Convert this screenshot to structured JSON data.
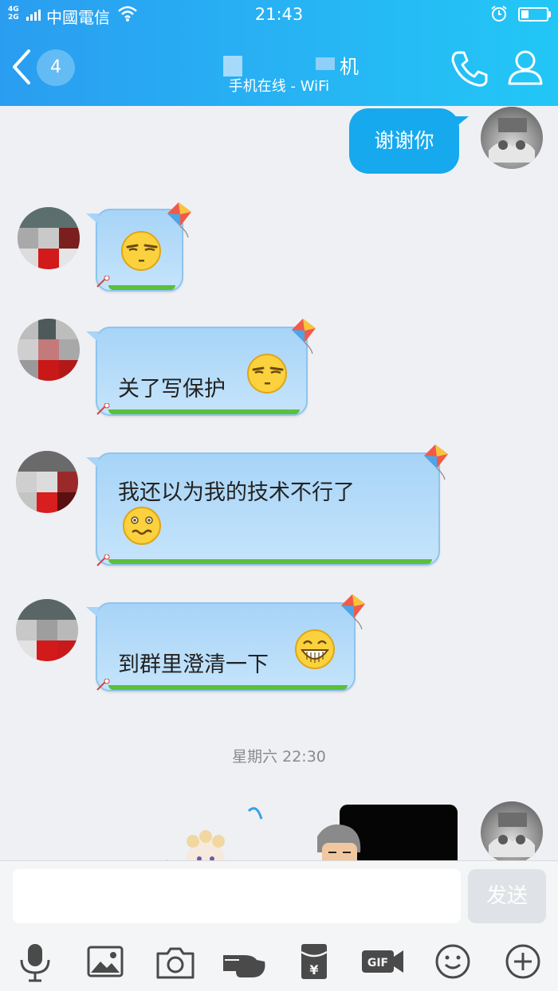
{
  "status_bar": {
    "network_type": "4G 2G",
    "carrier": "中國電信",
    "time": "21:43",
    "battery_level": 0.3
  },
  "header": {
    "unread_count": "4",
    "title_suffix": "机",
    "subtitle": "手机在线 - WiFi",
    "colors": {
      "gradient_start": "#2a9df0",
      "gradient_end": "#22c7f6"
    }
  },
  "messages": [
    {
      "sender": "me",
      "text": "谢谢你"
    },
    {
      "sender": "other",
      "text": "",
      "emoji": "smirk-face"
    },
    {
      "sender": "other",
      "text": "关了写保护",
      "emoji": "smirk-face"
    },
    {
      "sender": "other",
      "text": "我还以为我的技术不行了",
      "emoji": "awkward-face"
    },
    {
      "sender": "other",
      "text": "到群里澄清一下",
      "emoji": "grin-face"
    }
  ],
  "timestamp": "星期六 22:30",
  "composer": {
    "input_value": "",
    "send_label": "发送"
  },
  "toolbar": {
    "icons": [
      "microphone-icon",
      "image-icon",
      "camera-icon",
      "poke-hand-icon",
      "red-envelope-icon",
      "gif-icon",
      "emoji-icon",
      "plus-icon"
    ],
    "gif_label": "GIF",
    "yuan_label": "¥"
  }
}
